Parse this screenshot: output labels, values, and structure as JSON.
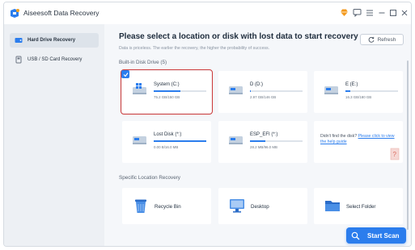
{
  "app": {
    "title": "Aiseesoft Data Recovery"
  },
  "sidebar": {
    "items": [
      {
        "label": "Hard Drive Recovery",
        "active": true
      },
      {
        "label": "USB / SD Card Recovery",
        "active": false
      }
    ]
  },
  "main": {
    "heading": "Please select a location or disk with lost data to start recovery",
    "subheading": "Data is priceless. The earlier the recovery, the higher the probability of success.",
    "refresh_label": "Refresh",
    "builtin_label": "Built-in Disk Drive (5)",
    "drives": [
      {
        "name": "System (C:)",
        "size": "75.2 GB/150 GB",
        "usage": 0.5,
        "selected": true
      },
      {
        "name": "D (D:)",
        "size": "2.97 GB/146 GB",
        "usage": 0.02,
        "selected": false
      },
      {
        "name": "E (E:)",
        "size": "16.3 GB/180 GB",
        "usage": 0.09,
        "selected": false
      },
      {
        "name": "Lost Disk (*:)",
        "size": "0.00 B/16.0 MB",
        "usage": 1.0,
        "selected": false
      },
      {
        "name": "ESP_EFI (*:)",
        "size": "28.2 MB/96.0 MB",
        "usage": 0.29,
        "selected": false
      }
    ],
    "help": {
      "prefix": "Didn't find the disk? ",
      "link": "Please click to view the help guide"
    },
    "location_label": "Specific Location Recovery",
    "locations": [
      {
        "label": "Recycle Bin"
      },
      {
        "label": "Desktop"
      },
      {
        "label": "Select Folder"
      }
    ],
    "start_scan_label": "Start Scan"
  },
  "colors": {
    "accent": "#2b7ded",
    "selected_outline": "#cc3a3a",
    "sidebar_bg": "#edf0f4",
    "main_bg": "#f5f7fa"
  }
}
